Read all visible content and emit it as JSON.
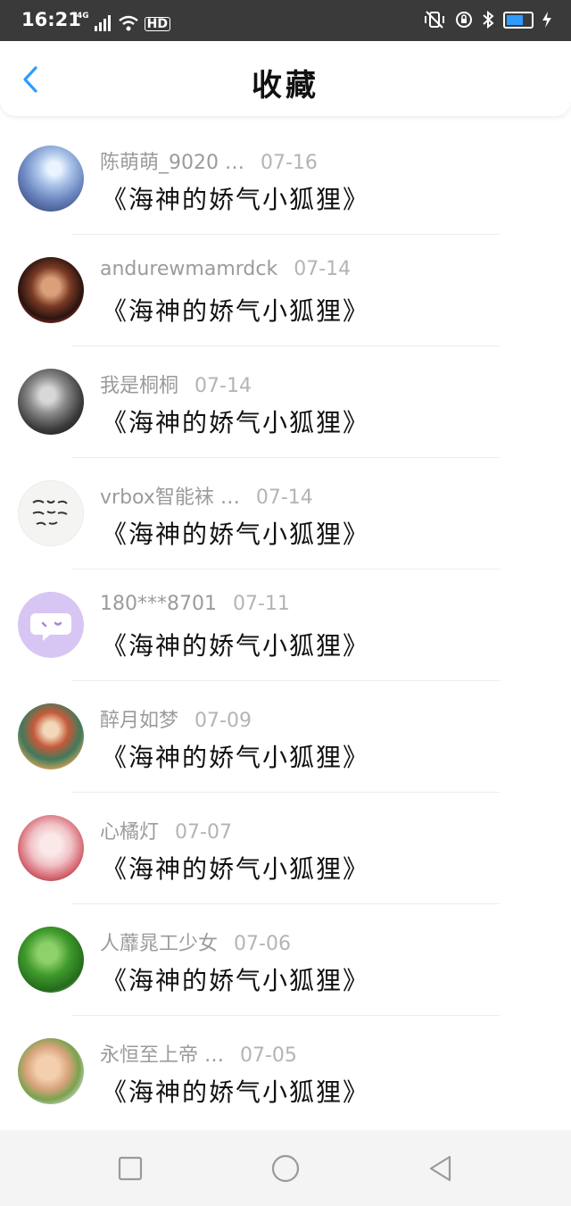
{
  "status_bar": {
    "time": "16:21",
    "network": "4G",
    "hd": "HD"
  },
  "header": {
    "title": "收藏",
    "back_icon": "chevron-left-icon"
  },
  "items": [
    {
      "user": "陈萌萌_9020 …",
      "date": "07-16",
      "book": "《海神的娇气小狐狸》"
    },
    {
      "user": "andurewmamrdck",
      "date": "07-14",
      "book": "《海神的娇气小狐狸》"
    },
    {
      "user": "我是桐桐",
      "date": "07-14",
      "book": "《海神的娇气小狐狸》"
    },
    {
      "user": "vrbox智能袜 …",
      "date": "07-14",
      "book": "《海神的娇气小狐狸》"
    },
    {
      "user": "180***8701",
      "date": "07-11",
      "book": "《海神的娇气小狐狸》"
    },
    {
      "user": "醉月如梦",
      "date": "07-09",
      "book": "《海神的娇气小狐狸》"
    },
    {
      "user": "心橘灯",
      "date": "07-07",
      "book": "《海神的娇气小狐狸》"
    },
    {
      "user": "人蘼晁工少女",
      "date": "07-06",
      "book": "《海神的娇气小狐狸》"
    },
    {
      "user": "永恒至上帝 …",
      "date": "07-05",
      "book": "《海神的娇气小狐狸》"
    }
  ],
  "nav_bar": {
    "recent_icon": "square-icon",
    "home_icon": "circle-icon",
    "back_icon": "triangle-back-icon"
  },
  "colors": {
    "status_bg": "#3a3a3a",
    "accent": "#2f9bff",
    "meta_text": "#9b9b9b"
  }
}
